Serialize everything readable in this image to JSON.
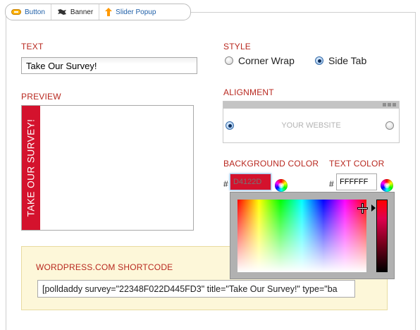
{
  "tabs": [
    {
      "label": "Button",
      "icon": "button-pill-icon"
    },
    {
      "label": "Banner",
      "icon": "banner-flag-icon"
    },
    {
      "label": "Slider Popup",
      "icon": "slider-up-arrow-icon"
    }
  ],
  "text_section": {
    "label": "TEXT",
    "value": "Take Our Survey!"
  },
  "preview_section": {
    "label": "PREVIEW",
    "tab_text": "TAKE OUR SURVEY!"
  },
  "style_section": {
    "label": "STYLE",
    "options": [
      {
        "label": "Corner Wrap",
        "selected": false
      },
      {
        "label": "Side Tab",
        "selected": true
      }
    ]
  },
  "alignment_section": {
    "label": "ALIGNMENT",
    "placeholder_text": "YOUR WEBSITE",
    "options": [
      {
        "position": "left",
        "selected": true
      },
      {
        "position": "right",
        "selected": false
      }
    ]
  },
  "background_color": {
    "label": "BACKGROUND COLOR",
    "hash": "#",
    "value": "",
    "placeholder": "D4122D"
  },
  "text_color": {
    "label": "TEXT COLOR",
    "hash": "#",
    "value": "FFFFFF"
  },
  "shortcode_section": {
    "label": "WORDPRESS.COM SHORTCODE",
    "value": "[polldaddy survey=\"22348F022D445FD3\" title=\"Take Our Survey!\" type=\"ba"
  },
  "colors": {
    "label_red": "#b8281f",
    "tab_red": "#d4122d",
    "link_blue": "#1f5fa8",
    "panel_yellow": "#fdf7d9"
  }
}
